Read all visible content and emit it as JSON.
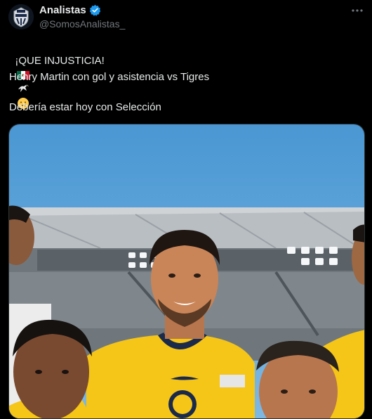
{
  "account": {
    "display_name": "Analistas",
    "handle": "@SomosAnalistas_",
    "verified": true
  },
  "tweet": {
    "line1": "¡QUE INJUSTICIA!",
    "line2": "Henry Martin con gol y asistencia vs Tigres",
    "line3": "Debería estar hoy con Selección",
    "emojis": [
      "mexico-flag",
      "eagle",
      "crying-face"
    ]
  },
  "icons": {
    "verified": "verified-badge-icon",
    "more": "more-options-icon"
  },
  "colors": {
    "background": "#000000",
    "text": "#e7e9ea",
    "secondary": "#71767b",
    "verified": "#1d9bf0",
    "jersey": "#f5c518",
    "jersey_trim": "#1b2a4a"
  }
}
